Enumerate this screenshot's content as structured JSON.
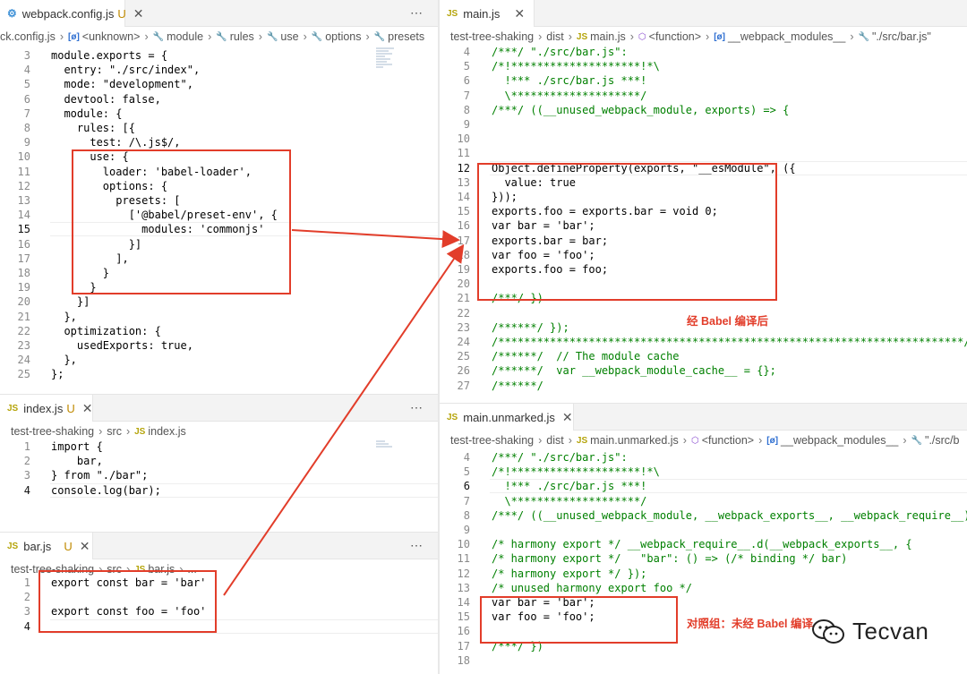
{
  "panes": {
    "webpack_config": {
      "tab": {
        "icon": "gear-file-icon",
        "name": "webpack.config.js",
        "modified": "U",
        "close": "✕"
      },
      "more": "⋯",
      "breadcrumb": [
        {
          "icon": "",
          "text": "ck.config.js"
        },
        {
          "icon": "brackets-icon",
          "text": "<unknown>"
        },
        {
          "icon": "wrench-icon",
          "text": "module"
        },
        {
          "icon": "wrench-icon",
          "text": "rules"
        },
        {
          "icon": "wrench-icon",
          "text": "use"
        },
        {
          "icon": "wrench-icon",
          "text": "options"
        },
        {
          "icon": "wrench-icon",
          "text": "presets"
        }
      ],
      "current_line": "15",
      "lines": [
        {
          "n": "3",
          "t": "module.exports = {"
        },
        {
          "n": "4",
          "t": "  entry: \"./src/index\","
        },
        {
          "n": "5",
          "t": "  mode: \"development\","
        },
        {
          "n": "6",
          "t": "  devtool: false,"
        },
        {
          "n": "7",
          "t": "  module: {"
        },
        {
          "n": "8",
          "t": "    rules: [{"
        },
        {
          "n": "9",
          "t": "      test: /\\.js$/,"
        },
        {
          "n": "10",
          "t": "      use: {"
        },
        {
          "n": "11",
          "t": "        loader: 'babel-loader',"
        },
        {
          "n": "12",
          "t": "        options: {"
        },
        {
          "n": "13",
          "t": "          presets: ["
        },
        {
          "n": "14",
          "t": "            ['@babel/preset-env', {"
        },
        {
          "n": "15",
          "t": "              modules: 'commonjs'"
        },
        {
          "n": "16",
          "t": "            }]"
        },
        {
          "n": "17",
          "t": "          ],"
        },
        {
          "n": "18",
          "t": "        }"
        },
        {
          "n": "19",
          "t": "      }"
        },
        {
          "n": "20",
          "t": "    }]"
        },
        {
          "n": "21",
          "t": "  },"
        },
        {
          "n": "22",
          "t": "  optimization: {"
        },
        {
          "n": "23",
          "t": "    usedExports: true,"
        },
        {
          "n": "24",
          "t": "  },"
        },
        {
          "n": "25",
          "t": "};"
        }
      ]
    },
    "index_js": {
      "tab": {
        "icon": "js-file-icon",
        "name": "index.js",
        "modified": "U",
        "close": "✕"
      },
      "more": "⋯",
      "breadcrumb": [
        {
          "icon": "",
          "text": "test-tree-shaking"
        },
        {
          "icon": "",
          "text": "src"
        },
        {
          "icon": "js-icon",
          "text": "index.js"
        }
      ],
      "current_line": "4",
      "lines": [
        {
          "n": "1",
          "t": "import {"
        },
        {
          "n": "2",
          "t": "    bar,"
        },
        {
          "n": "3",
          "t": "} from \"./bar\";"
        },
        {
          "n": "4",
          "t": "console.log(bar);"
        }
      ]
    },
    "bar_js": {
      "tab": {
        "icon": "js-file-icon",
        "name": "bar.js",
        "modified": "U",
        "close": "✕"
      },
      "more": "⋯",
      "breadcrumb": [
        {
          "icon": "",
          "text": "test-tree-shaking"
        },
        {
          "icon": "",
          "text": "src"
        },
        {
          "icon": "js-icon",
          "text": "bar.js"
        },
        {
          "icon": "",
          "text": "..."
        }
      ],
      "current_line": "4",
      "lines": [
        {
          "n": "1",
          "t": "export const bar = 'bar'"
        },
        {
          "n": "2",
          "t": ""
        },
        {
          "n": "3",
          "t": "export const foo = 'foo'"
        },
        {
          "n": "4",
          "t": ""
        }
      ]
    },
    "main_js": {
      "tab": {
        "icon": "js-file-icon",
        "name": "main.js",
        "modified": "",
        "close": "✕"
      },
      "breadcrumb": [
        {
          "icon": "",
          "text": "test-tree-shaking"
        },
        {
          "icon": "",
          "text": "dist"
        },
        {
          "icon": "js-icon",
          "text": "main.js"
        },
        {
          "icon": "cube-icon",
          "text": "<function>"
        },
        {
          "icon": "brackets-icon",
          "text": "__webpack_modules__"
        },
        {
          "icon": "wrench-icon",
          "text": "\"./src/bar.js\""
        }
      ],
      "current_line": "12",
      "lines": [
        {
          "n": "4",
          "t": "/***/ \"./src/bar.js\":"
        },
        {
          "n": "5",
          "t": "/*!********************!*\\"
        },
        {
          "n": "6",
          "t": "  !*** ./src/bar.js ***!"
        },
        {
          "n": "7",
          "t": "  \\********************/"
        },
        {
          "n": "8",
          "t": "/***/ ((__unused_webpack_module, exports) => {"
        },
        {
          "n": "9",
          "t": ""
        },
        {
          "n": "10",
          "t": ""
        },
        {
          "n": "11",
          "t": ""
        },
        {
          "n": "12",
          "t": "Object.defineProperty(exports, \"__esModule\", ({"
        },
        {
          "n": "13",
          "t": "  value: true"
        },
        {
          "n": "14",
          "t": "}));"
        },
        {
          "n": "15",
          "t": "exports.foo = exports.bar = void 0;"
        },
        {
          "n": "16",
          "t": "var bar = 'bar';"
        },
        {
          "n": "17",
          "t": "exports.bar = bar;"
        },
        {
          "n": "18",
          "t": "var foo = 'foo';"
        },
        {
          "n": "19",
          "t": "exports.foo = foo;"
        },
        {
          "n": "20",
          "t": ""
        },
        {
          "n": "21",
          "t": "/***/ })"
        },
        {
          "n": "22",
          "t": ""
        },
        {
          "n": "23",
          "t": "/******/ });"
        },
        {
          "n": "24",
          "t": "/************************************************************************/"
        },
        {
          "n": "25",
          "t": "/******/  // The module cache"
        },
        {
          "n": "26",
          "t": "/******/  var __webpack_module_cache__ = {};"
        },
        {
          "n": "27",
          "t": "/******/"
        }
      ]
    },
    "main_unmarked_js": {
      "tab": {
        "icon": "js-file-icon",
        "name": "main.unmarked.js",
        "modified": "",
        "close": "✕"
      },
      "breadcrumb": [
        {
          "icon": "",
          "text": "test-tree-shaking"
        },
        {
          "icon": "",
          "text": "dist"
        },
        {
          "icon": "js-icon",
          "text": "main.unmarked.js"
        },
        {
          "icon": "cube-icon",
          "text": "<function>"
        },
        {
          "icon": "brackets-icon",
          "text": "__webpack_modules__"
        },
        {
          "icon": "wrench-icon",
          "text": "\"./src/b"
        }
      ],
      "current_line": "6",
      "lines": [
        {
          "n": "4",
          "t": "/***/ \"./src/bar.js\":"
        },
        {
          "n": "5",
          "t": "/*!********************!*\\"
        },
        {
          "n": "6",
          "t": "  !*** ./src/bar.js ***!"
        },
        {
          "n": "7",
          "t": "  \\********************/"
        },
        {
          "n": "8",
          "t": "/***/ ((__unused_webpack_module, __webpack_exports__, __webpack_require__) => {"
        },
        {
          "n": "9",
          "t": ""
        },
        {
          "n": "10",
          "t": "/* harmony export */ __webpack_require__.d(__webpack_exports__, {"
        },
        {
          "n": "11",
          "t": "/* harmony export */   \"bar\": () => (/* binding */ bar)"
        },
        {
          "n": "12",
          "t": "/* harmony export */ });"
        },
        {
          "n": "13",
          "t": "/* unused harmony export foo */"
        },
        {
          "n": "14",
          "t": "var bar = 'bar';"
        },
        {
          "n": "15",
          "t": "var foo = 'foo';"
        },
        {
          "n": "16",
          "t": ""
        },
        {
          "n": "17",
          "t": "/***/ })"
        },
        {
          "n": "18",
          "t": ""
        }
      ]
    }
  },
  "annotations": {
    "after_babel": "经 Babel 编译后",
    "control_group": "对照组：未经 Babel 编译"
  },
  "watermark": {
    "text": "Tecvan",
    "icon": "wechat-icon"
  },
  "colors": {
    "highlight": "#e23d2a",
    "keyword": "#0000ff",
    "string": "#a31515",
    "comment": "#008000",
    "property": "#001080"
  }
}
